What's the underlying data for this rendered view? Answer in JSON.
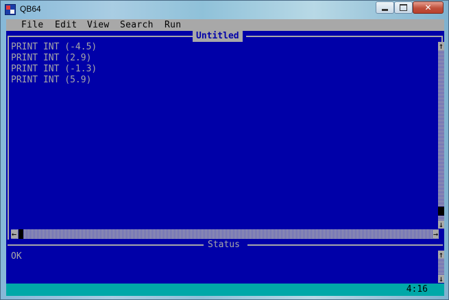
{
  "window": {
    "title": "QB64",
    "controls": {
      "minimize": "minimize",
      "maximize": "maximize",
      "close": "✕"
    }
  },
  "menu": {
    "items": [
      {
        "label": "File"
      },
      {
        "label": "Edit"
      },
      {
        "label": "View"
      },
      {
        "label": "Search"
      },
      {
        "label": "Run"
      }
    ]
  },
  "editor": {
    "title": "Untitled",
    "lines": [
      "PRINT INT (-4.5)",
      "PRINT INT (2.9)",
      "PRINT INT (-1.3)",
      "PRINT INT (5.9)"
    ],
    "scroll": {
      "up": "↑",
      "down": "↓",
      "left": "←",
      "right": "→"
    }
  },
  "status": {
    "title": "Status",
    "text": "OK"
  },
  "cursor_position": "4:16",
  "colors": {
    "editor_background": "#0000a8",
    "text": "#a8a8a8",
    "menu_bar": "#a8a8a8",
    "bottom_bar": "#00a8a8"
  },
  "icons": {
    "app": "qb64-icon",
    "minimize": "minimize-icon",
    "maximize": "maximize-icon",
    "close": "close-icon"
  }
}
